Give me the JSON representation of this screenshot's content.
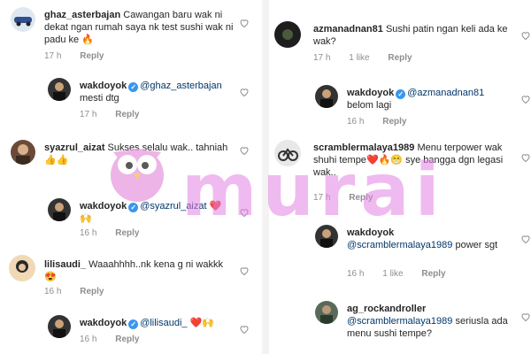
{
  "left": [
    {
      "user": "ghaz_asterbajan",
      "verified": false,
      "text": "Cawangan baru wak ni dekat ngan rumah saya nk test sushi wak ni padu ke",
      "emoji": "🔥",
      "mention": "",
      "time": "17 h",
      "likes": "",
      "reply": "Reply"
    },
    {
      "user": "wakdoyok",
      "verified": true,
      "mention": "@ghaz_asterbajan",
      "text": "mesti dtg",
      "emoji": "",
      "time": "17 h",
      "likes": "",
      "reply": "Reply"
    },
    {
      "user": "syazrul_aizat",
      "verified": false,
      "text": "Sukses selalu wak.. tahniah",
      "emoji": "👍👍",
      "mention": "",
      "time": "",
      "likes": "",
      "reply": ""
    },
    {
      "user": "wakdoyok",
      "verified": true,
      "mention": "@syazrul_aizat",
      "text": "",
      "emoji": "❤️🙌",
      "time": "16 h",
      "likes": "",
      "reply": "Reply"
    },
    {
      "user": "lilisaudi_",
      "verified": false,
      "text": "Waaahhhh..nk kena g ni wakkk",
      "emoji": "😍",
      "mention": "",
      "time": "16 h",
      "likes": "",
      "reply": "Reply"
    },
    {
      "user": "wakdoyok",
      "verified": true,
      "mention": "@lilisaudi_",
      "text": "",
      "emoji": "❤️🙌",
      "time": "16 h",
      "likes": "",
      "reply": "Reply"
    }
  ],
  "right": [
    {
      "user": "azmanadnan81",
      "verified": false,
      "text": "Sushi patin ngan keli ada ke wak?",
      "emoji": "",
      "mention": "",
      "time": "17 h",
      "likes": "1 like",
      "reply": "Reply"
    },
    {
      "user": "wakdoyok",
      "verified": true,
      "mention": "@azmanadnan81",
      "text": "belom lagi",
      "emoji": "",
      "time": "16 h",
      "likes": "",
      "reply": "Reply"
    },
    {
      "user": "scramblermalaya1989",
      "verified": false,
      "text": "Menu terpower wak shuhi tempe",
      "emoji": "❤️🔥😁",
      "text2": "sye bangga dgn legasi wak..",
      "mention": "",
      "time": "17 h",
      "likes": "",
      "reply": "Reply"
    },
    {
      "user": "wakdoyok",
      "verified": false,
      "mention": "@scramblermalaya1989",
      "text": "power sgt",
      "emoji": "",
      "time": "16 h",
      "likes": "1 like",
      "reply": "Reply"
    },
    {
      "user": "ag_rockandroller",
      "verified": false,
      "mention": "@scramblermalaya1989",
      "text": "seriusla ada menu sushi tempe?",
      "emoji": "",
      "time": "",
      "likes": "",
      "reply": ""
    }
  ],
  "watermark": {
    "text": "murai",
    "color": "#e282e2"
  },
  "icons": {
    "heart": "heart-outline-icon",
    "verified": "verified-badge-icon"
  },
  "colors": {
    "text": "#262626",
    "meta": "#8e8e8e",
    "mention": "#00376b",
    "badge": "#3897f0"
  }
}
